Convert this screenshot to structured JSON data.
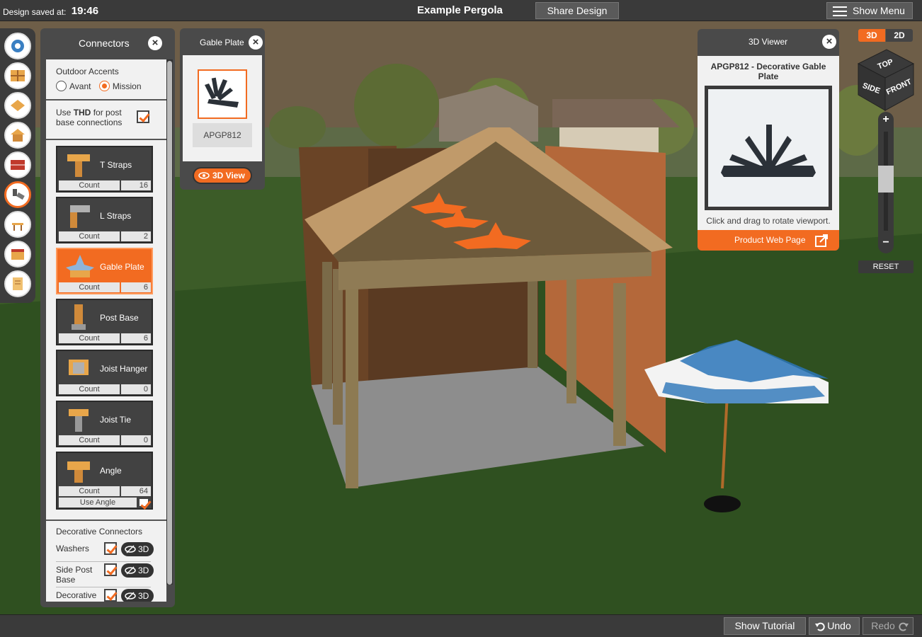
{
  "header": {
    "saved_label": "Design saved at:",
    "saved_time": "19:46",
    "design_title": "Example Pergola",
    "share_label": "Share Design",
    "menu_label": "Show Menu"
  },
  "toolbar": {
    "tools": [
      "settings-icon",
      "framing-icon",
      "lumber-icon",
      "house-icon",
      "brick-icon",
      "connector-icon",
      "furniture-icon",
      "store-icon",
      "document-icon"
    ],
    "active": "connector-icon"
  },
  "connectors": {
    "title": "Connectors",
    "outdoor_accents_label": "Outdoor Accents",
    "style_options": [
      "Avant",
      "Mission"
    ],
    "style_selected": "Mission",
    "use_label_pre": "Use ",
    "use_label_bold": "THD",
    "use_label_post": " for post base connections",
    "use_thd_checked": true,
    "count_label": "Count",
    "items": [
      {
        "name": "T Straps",
        "count": "16"
      },
      {
        "name": "L Straps",
        "count": "2"
      },
      {
        "name": "Gable Plate",
        "count": "6"
      },
      {
        "name": "Post Base",
        "count": "6"
      },
      {
        "name": "Joist Hanger",
        "count": "0"
      },
      {
        "name": "Joist Tie",
        "count": "0"
      },
      {
        "name": "Angle",
        "count": "64"
      }
    ],
    "selected_item": "Gable Plate",
    "use_angle_label": "Use Angle",
    "use_angle_checked": true,
    "decorative_title": "Decorative Connectors",
    "decorative": [
      {
        "name": "Washers",
        "checked": true,
        "view_label": "3D"
      },
      {
        "name": "Side Post Base",
        "checked": true,
        "view_label": "3D"
      },
      {
        "name": "Decorative",
        "checked": true,
        "view_label": "3D"
      }
    ]
  },
  "gable_panel": {
    "title": "Gable Plate",
    "code": "APGP812",
    "view_label": "3D View"
  },
  "viewer": {
    "title": "3D Viewer",
    "product_title": "APGP812 - Decorative Gable Plate",
    "hint": "Click and drag to rotate viewport.",
    "web_label": "Product Web Page"
  },
  "view_controls": {
    "mode_3d": "3D",
    "mode_2d": "2D",
    "active_mode": "3D",
    "cube_top": "TOP",
    "cube_side": "SIDE",
    "cube_front": "FRONT",
    "zoom_in": "+",
    "zoom_out": "−",
    "reset_label": "RESET"
  },
  "footer": {
    "tutorial_label": "Show Tutorial",
    "undo_label": "Undo",
    "redo_label": "Redo"
  },
  "colors": {
    "accent": "#f26b21",
    "panel": "#4a4a4a",
    "bar": "#3a3a3a"
  }
}
